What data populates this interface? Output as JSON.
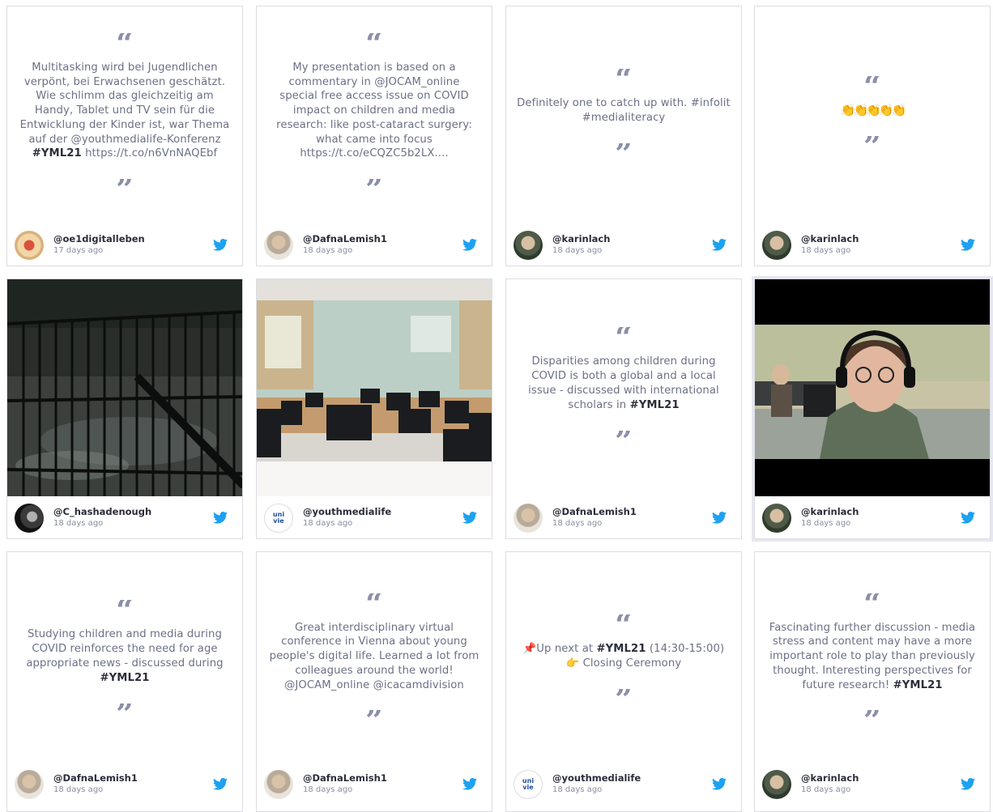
{
  "cards": [
    {
      "user": "@oe1digitalleben",
      "time": "17 days ago",
      "text_parts": [
        "Multitasking wird bei Jugendlichen verpönt, bei Erwachsenen geschätzt. Wie schlimm das gleichzeitig am Handy, Tablet und TV sein für die Entwicklung der Kinder ist, war Thema auf der @youthmedialife-Konferenz ",
        "#YML21",
        " https://t.co/n6VnNAQEbf"
      ]
    },
    {
      "user": "@DafnaLemish1",
      "time": "18 days ago",
      "text_parts": [
        "My presentation is based on a commentary in @JOCAM_online special free access issue on COVID impact on children and media research: like post-cataract surgery: what came into focus https://t.co/eCQZC5b2LX...."
      ]
    },
    {
      "user": "@karinlach",
      "time": "18 days ago",
      "text_parts": [
        "Definitely one to catch up with. #infolit #medialiteracy"
      ]
    },
    {
      "user": "@karinlach",
      "time": "18 days ago",
      "text_parts": [
        "👏👏👏👏👏"
      ]
    },
    {
      "user": "@C_hashadenough",
      "time": "18 days ago"
    },
    {
      "user": "@youthmedialife",
      "time": "18 days ago"
    },
    {
      "user": "@DafnaLemish1",
      "time": "18 days ago",
      "text_parts": [
        "Disparities among children during COVID is both a global and a local issue - discussed with international scholars in ",
        "#YML21"
      ]
    },
    {
      "user": "@karinlach",
      "time": "18 days ago"
    },
    {
      "user": "@DafnaLemish1",
      "time": "18 days ago",
      "text_parts": [
        "Studying children and media during COVID reinforces the need for age appropriate news - discussed during ",
        "#YML21"
      ]
    },
    {
      "user": "@DafnaLemish1",
      "time": "18 days ago",
      "text_parts": [
        "Great interdisciplinary virtual conference in Vienna about young people's digital life. Learned a lot from colleagues around the world! @JOCAM_online @icacamdivision"
      ]
    },
    {
      "user": "@youthmedialife",
      "time": "18 days ago",
      "text_parts": [
        "📌Up next at ",
        "#YML21",
        " (14:30-15:00) 👉 Closing Ceremony"
      ]
    },
    {
      "user": "@karinlach",
      "time": "18 days ago",
      "text_parts": [
        "Fascinating further discussion - media stress and content may have a more important role to play than previously thought. Interesting perspectives for future research! ",
        "#YML21"
      ]
    }
  ],
  "quote_open": "“",
  "quote_close": "”",
  "avatar_label": "uni vie",
  "colors": {
    "twitter": "#1da1f2",
    "quote": "#8b8fa8",
    "text": "#6d7086",
    "hashtag": "#2b2d3a"
  }
}
